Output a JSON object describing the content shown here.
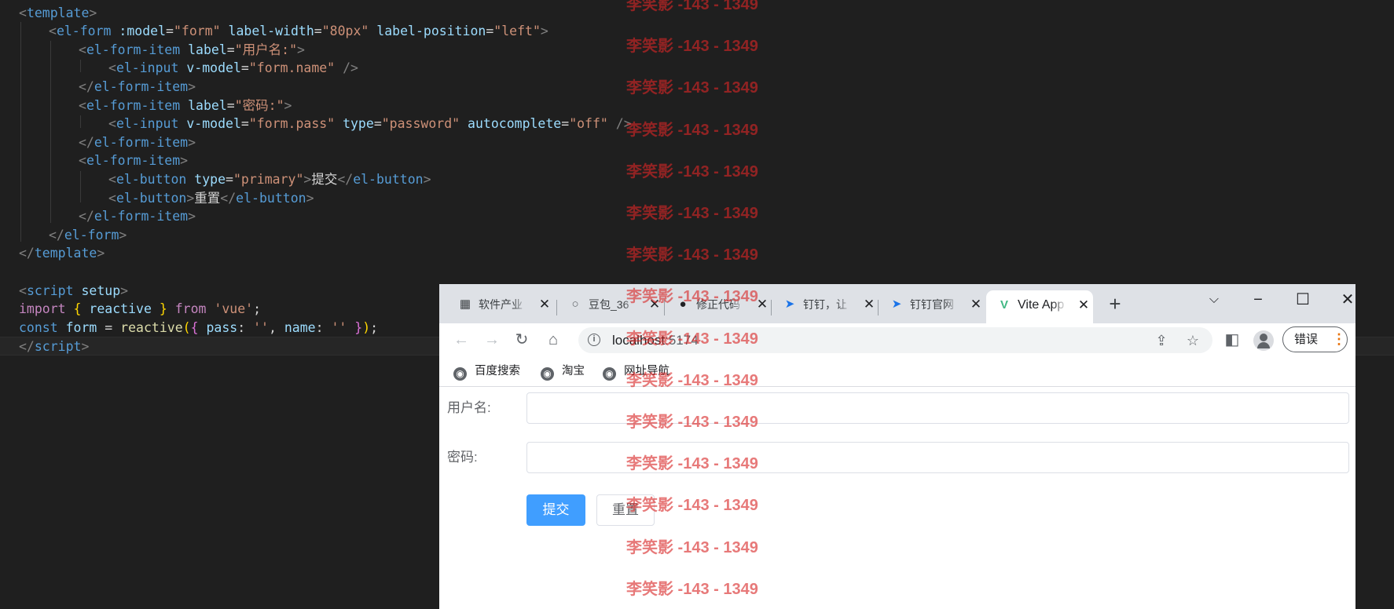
{
  "editor": {
    "lines": [
      [
        [
          "t-b",
          "<"
        ],
        [
          "t-tag",
          "template"
        ],
        [
          "t-b",
          ">"
        ]
      ],
      [
        [
          "t-b",
          "<"
        ],
        [
          "t-tag",
          "el-form"
        ],
        [
          "t-text",
          " "
        ],
        [
          "t-attr",
          ":model"
        ],
        [
          "t-eq",
          "="
        ],
        [
          "t-str",
          "\"form\""
        ],
        [
          "t-text",
          " "
        ],
        [
          "t-attr",
          "label-width"
        ],
        [
          "t-eq",
          "="
        ],
        [
          "t-str",
          "\"80px\""
        ],
        [
          "t-text",
          " "
        ],
        [
          "t-attr",
          "label-position"
        ],
        [
          "t-eq",
          "="
        ],
        [
          "t-str",
          "\"left\""
        ],
        [
          "t-b",
          ">"
        ]
      ],
      [
        [
          "t-b",
          "<"
        ],
        [
          "t-tag",
          "el-form-item"
        ],
        [
          "t-text",
          " "
        ],
        [
          "t-attr",
          "label"
        ],
        [
          "t-eq",
          "="
        ],
        [
          "t-str",
          "\"用户名:\""
        ],
        [
          "t-b",
          ">"
        ]
      ],
      [
        [
          "t-b",
          "<"
        ],
        [
          "t-tag",
          "el-input"
        ],
        [
          "t-text",
          " "
        ],
        [
          "t-attr",
          "v-model"
        ],
        [
          "t-eq",
          "="
        ],
        [
          "t-str",
          "\"form.name\""
        ],
        [
          "t-text",
          " "
        ],
        [
          "t-b",
          "/>"
        ]
      ],
      [
        [
          "t-b",
          "</"
        ],
        [
          "t-tag",
          "el-form-item"
        ],
        [
          "t-b",
          ">"
        ]
      ],
      [
        [
          "t-b",
          "<"
        ],
        [
          "t-tag",
          "el-form-item"
        ],
        [
          "t-text",
          " "
        ],
        [
          "t-attr",
          "label"
        ],
        [
          "t-eq",
          "="
        ],
        [
          "t-str",
          "\"密码:\""
        ],
        [
          "t-b",
          ">"
        ]
      ],
      [
        [
          "t-b",
          "<"
        ],
        [
          "t-tag",
          "el-input"
        ],
        [
          "t-text",
          " "
        ],
        [
          "t-attr",
          "v-model"
        ],
        [
          "t-eq",
          "="
        ],
        [
          "t-str",
          "\"form.pass\""
        ],
        [
          "t-text",
          " "
        ],
        [
          "t-attr",
          "type"
        ],
        [
          "t-eq",
          "="
        ],
        [
          "t-str",
          "\"password\""
        ],
        [
          "t-text",
          " "
        ],
        [
          "t-attr",
          "autocomplete"
        ],
        [
          "t-eq",
          "="
        ],
        [
          "t-str",
          "\"off\""
        ],
        [
          "t-text",
          " "
        ],
        [
          "t-b",
          "/>"
        ]
      ],
      [
        [
          "t-b",
          "</"
        ],
        [
          "t-tag",
          "el-form-item"
        ],
        [
          "t-b",
          ">"
        ]
      ],
      [
        [
          "t-b",
          "<"
        ],
        [
          "t-tag",
          "el-form-item"
        ],
        [
          "t-b",
          ">"
        ]
      ],
      [
        [
          "t-b",
          "<"
        ],
        [
          "t-tag",
          "el-button"
        ],
        [
          "t-text",
          " "
        ],
        [
          "t-attr",
          "type"
        ],
        [
          "t-eq",
          "="
        ],
        [
          "t-str",
          "\"primary\""
        ],
        [
          "t-b",
          ">"
        ],
        [
          "t-text",
          "提交"
        ],
        [
          "t-b",
          "</"
        ],
        [
          "t-tag",
          "el-button"
        ],
        [
          "t-b",
          ">"
        ]
      ],
      [
        [
          "t-b",
          "<"
        ],
        [
          "t-tag",
          "el-button"
        ],
        [
          "t-b",
          ">"
        ],
        [
          "t-text",
          "重置"
        ],
        [
          "t-b",
          "</"
        ],
        [
          "t-tag",
          "el-button"
        ],
        [
          "t-b",
          ">"
        ]
      ],
      [
        [
          "t-b",
          "</"
        ],
        [
          "t-tag",
          "el-form-item"
        ],
        [
          "t-b",
          ">"
        ]
      ],
      [
        [
          "t-b",
          "</"
        ],
        [
          "t-tag",
          "el-form"
        ],
        [
          "t-b",
          ">"
        ]
      ],
      [
        [
          "t-b",
          "</"
        ],
        [
          "t-tag",
          "template"
        ],
        [
          "t-b",
          ">"
        ]
      ],
      [],
      [
        [
          "t-b",
          "<"
        ],
        [
          "t-tag",
          "script"
        ],
        [
          "t-text",
          " "
        ],
        [
          "t-attr",
          "setup"
        ],
        [
          "t-b",
          ">"
        ]
      ],
      [
        [
          "t-kw",
          "import"
        ],
        [
          "t-text",
          " "
        ],
        [
          "t-br1",
          "{"
        ],
        [
          "t-text",
          " "
        ],
        [
          "t-attr",
          "reactive"
        ],
        [
          "t-text",
          " "
        ],
        [
          "t-br1",
          "}"
        ],
        [
          "t-text",
          " "
        ],
        [
          "t-kw",
          "from"
        ],
        [
          "t-text",
          " "
        ],
        [
          "t-str",
          "'vue'"
        ],
        [
          "t-text",
          ";"
        ]
      ],
      [
        [
          "t-tag",
          "const"
        ],
        [
          "t-text",
          " "
        ],
        [
          "t-attr",
          "form"
        ],
        [
          "t-text",
          " = "
        ],
        [
          "t-fn",
          "reactive"
        ],
        [
          "t-br1",
          "("
        ],
        [
          "t-br2",
          "{"
        ],
        [
          "t-text",
          " "
        ],
        [
          "t-attr",
          "pass"
        ],
        [
          "t-text",
          ": "
        ],
        [
          "t-str",
          "''"
        ],
        [
          "t-text",
          ", "
        ],
        [
          "t-attr",
          "name"
        ],
        [
          "t-text",
          ": "
        ],
        [
          "t-str",
          "''"
        ],
        [
          "t-text",
          " "
        ],
        [
          "t-br2",
          "}"
        ],
        [
          "t-br1",
          ")"
        ],
        [
          "t-text",
          ";"
        ]
      ],
      [
        [
          "t-b",
          "</"
        ],
        [
          "t-tag",
          "script"
        ],
        [
          "t-b",
          ">"
        ]
      ]
    ]
  },
  "browser": {
    "tabs": [
      {
        "label": "软件产业",
        "icon": "document-favicon-icon",
        "glyph": "▦"
      },
      {
        "label": "豆包_36",
        "icon": "search-favicon-icon",
        "glyph": "○"
      },
      {
        "label": "修正代码",
        "icon": "avatar-favicon-icon",
        "glyph": "●"
      },
      {
        "label": "钉钉，让",
        "icon": "dingtalk-favicon-icon",
        "glyph": "➤"
      },
      {
        "label": "钉钉官网",
        "icon": "dingtalk-favicon-icon",
        "glyph": "➤"
      }
    ],
    "active_tab": {
      "label": "Vite App",
      "icon": "vue-favicon-icon",
      "glyph": "V"
    },
    "new_tab_glyph": "+",
    "url_host": "localhost",
    "url_port": ":5174",
    "error_button": "错误",
    "bookmarks": [
      "百度搜索",
      "淘宝",
      "网址导航"
    ]
  },
  "form": {
    "name_label": "用户名:",
    "name_value": "",
    "pass_label": "密码:",
    "pass_value": "",
    "submit_label": "提交",
    "reset_label": "重置"
  },
  "colors": {
    "primary_button": "#409eff",
    "watermark": "#d82626",
    "vue_green": "#41b883"
  },
  "watermark": {
    "text": "李笑影 -143 - 1349",
    "count": 15
  }
}
